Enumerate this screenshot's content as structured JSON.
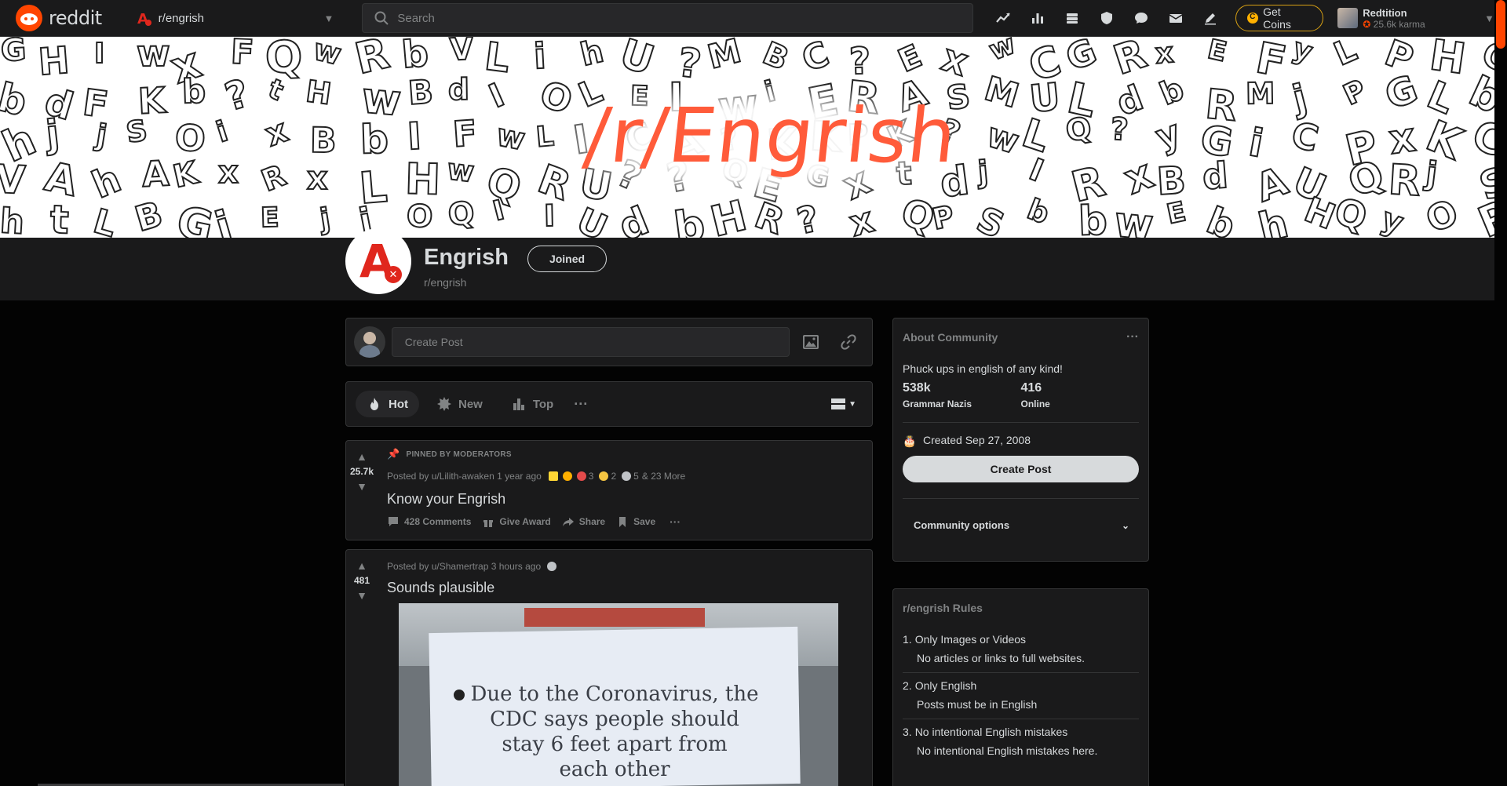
{
  "header": {
    "logo_text": "reddit",
    "community": "r/engrish",
    "search_placeholder": "Search",
    "coins_label": "Get Coins",
    "user_name": "Redtition",
    "user_karma": "25.6k karma",
    "icons": [
      "popular-icon",
      "stats-icon",
      "coins-stack-icon",
      "shield-icon",
      "chat-icon",
      "mail-icon",
      "pencil-icon"
    ]
  },
  "banner": {
    "title": "/r/Engrish"
  },
  "community": {
    "title": "Engrish",
    "subtitle": "r/engrish",
    "joined_label": "Joined"
  },
  "create_post": {
    "placeholder": "Create Post"
  },
  "sort": {
    "hot": "Hot",
    "new": "New",
    "top": "Top",
    "more": "···"
  },
  "posts": [
    {
      "pinned_label": "PINNED BY MODERATORS",
      "votes": "25.7k",
      "posted_by": "Posted by u/Lilith-awaken 1 year ago",
      "award_counts": [
        "3",
        "2",
        "5"
      ],
      "more_awards": "& 23 More",
      "title": "Know your Engrish",
      "comments": "428 Comments",
      "give_award": "Give Award",
      "share": "Share",
      "save": "Save"
    },
    {
      "votes": "481",
      "posted_by": "Posted by u/Shamertrap 3 hours ago",
      "title": "Sounds plausible",
      "image_text": [
        "Due to the Coronavirus, the",
        "CDC says people should",
        "stay 6 feet apart from",
        "each other"
      ]
    }
  ],
  "about": {
    "heading": "About Community",
    "description": "Phuck ups in english of any kind!",
    "members": "538k",
    "members_label": "Grammar Nazis",
    "online": "416",
    "online_label": "Online",
    "created": "Created Sep 27, 2008",
    "create_post_label": "Create Post",
    "options_label": "Community options"
  },
  "rules": {
    "heading": "r/engrish Rules",
    "items": [
      {
        "num": "1.",
        "title": "Only Images or Videos",
        "desc": "No articles or links to full websites."
      },
      {
        "num": "2.",
        "title": "Only English",
        "desc": "Posts must be in English"
      },
      {
        "num": "3.",
        "title": "No intentional English mistakes",
        "desc": "No intentional English mistakes here."
      }
    ]
  },
  "colors": {
    "accent": "#ff4500",
    "background": "#030303",
    "card": "#1a1a1b",
    "border": "#343536",
    "banner_title": "#ff5b3a"
  }
}
